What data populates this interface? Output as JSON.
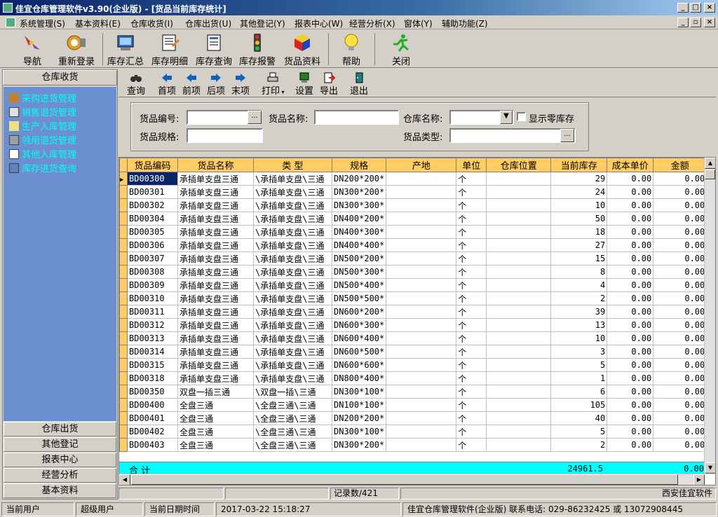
{
  "window": {
    "title": "佳宜仓库管理软件v3.90(企业版)  - [货品当前库存统计]"
  },
  "menu": [
    "系统管理(S)",
    "基本资料(E)",
    "仓库收货(I)",
    "仓库出货(U)",
    "其他登记(Y)",
    "报表中心(W)",
    "经营分析(X)",
    "窗体(Y)",
    "辅助功能(Z)"
  ],
  "toolbar": [
    {
      "label": "导航",
      "icon": "navigation-icon"
    },
    {
      "label": "重新登录",
      "icon": "relogin-icon"
    },
    {
      "label": "库存汇总",
      "icon": "inventory-summary-icon"
    },
    {
      "label": "库存明细",
      "icon": "inventory-detail-icon"
    },
    {
      "label": "库存查询",
      "icon": "inventory-query-icon"
    },
    {
      "label": "库存报警",
      "icon": "inventory-alarm-icon"
    },
    {
      "label": "货品资料",
      "icon": "goods-data-icon"
    },
    {
      "label": "帮助",
      "icon": "help-icon"
    },
    {
      "label": "关闭",
      "icon": "close-icon"
    }
  ],
  "sidebar": {
    "header": "仓库收货",
    "items": [
      "采购进货管理",
      "销售退货管理",
      "生产入库管理",
      "领用退货管理",
      "其他入库管理",
      "库存进货查询"
    ],
    "sections": [
      "仓库出货",
      "其他登记",
      "报表中心",
      "经营分析",
      "基本资料"
    ]
  },
  "subtoolbar": [
    "查询",
    "首项",
    "前项",
    "后项",
    "末项",
    "打印",
    "设置",
    "导出",
    "退出"
  ],
  "filter": {
    "code_label": "货品编号:",
    "name_label": "货品名称:",
    "warehouse_label": "仓库名称:",
    "zero_stock_label": "显示零库存",
    "spec_label": "货品规格:",
    "type_label": "货品类型:",
    "ellipsis": "..."
  },
  "grid": {
    "columns": [
      "货品编码",
      "货品名称",
      "类  型",
      "规格",
      "产地",
      "单位",
      "仓库位置",
      "当前库存",
      "成本单价",
      "金额"
    ],
    "rows": [
      [
        "BD00300",
        "承插单支盘三通",
        "\\承插单支盘\\三通",
        "DN200*200*",
        "",
        "个",
        "",
        "29",
        "0.00",
        "0.00"
      ],
      [
        "BD00301",
        "承插单支盘三通",
        "\\承插单支盘\\三通",
        "DN300*200*",
        "",
        "个",
        "",
        "24",
        "0.00",
        "0.00"
      ],
      [
        "BD00302",
        "承插单支盘三通",
        "\\承插单支盘\\三通",
        "DN300*300*",
        "",
        "个",
        "",
        "10",
        "0.00",
        "0.00"
      ],
      [
        "BD00304",
        "承插单支盘三通",
        "\\承插单支盘\\三通",
        "DN400*200*",
        "",
        "个",
        "",
        "50",
        "0.00",
        "0.00"
      ],
      [
        "BD00305",
        "承插单支盘三通",
        "\\承插单支盘\\三通",
        "DN400*300*",
        "",
        "个",
        "",
        "18",
        "0.00",
        "0.00"
      ],
      [
        "BD00306",
        "承插单支盘三通",
        "\\承插单支盘\\三通",
        "DN400*400*",
        "",
        "个",
        "",
        "27",
        "0.00",
        "0.00"
      ],
      [
        "BD00307",
        "承插单支盘三通",
        "\\承插单支盘\\三通",
        "DN500*200*",
        "",
        "个",
        "",
        "15",
        "0.00",
        "0.00"
      ],
      [
        "BD00308",
        "承插单支盘三通",
        "\\承插单支盘\\三通",
        "DN500*300*",
        "",
        "个",
        "",
        "8",
        "0.00",
        "0.00"
      ],
      [
        "BD00309",
        "承插单支盘三通",
        "\\承插单支盘\\三通",
        "DN500*400*",
        "",
        "个",
        "",
        "4",
        "0.00",
        "0.00"
      ],
      [
        "BD00310",
        "承插单支盘三通",
        "\\承插单支盘\\三通",
        "DN500*500*",
        "",
        "个",
        "",
        "2",
        "0.00",
        "0.00"
      ],
      [
        "BD00311",
        "承插单支盘三通",
        "\\承插单支盘\\三通",
        "DN600*200*",
        "",
        "个",
        "",
        "39",
        "0.00",
        "0.00"
      ],
      [
        "BD00312",
        "承插单支盘三通",
        "\\承插单支盘\\三通",
        "DN600*300*",
        "",
        "个",
        "",
        "13",
        "0.00",
        "0.00"
      ],
      [
        "BD00313",
        "承插单支盘三通",
        "\\承插单支盘\\三通",
        "DN600*400*",
        "",
        "个",
        "",
        "10",
        "0.00",
        "0.00"
      ],
      [
        "BD00314",
        "承插单支盘三通",
        "\\承插单支盘\\三通",
        "DN600*500*",
        "",
        "个",
        "",
        "3",
        "0.00",
        "0.00"
      ],
      [
        "BD00315",
        "承插单支盘三通",
        "\\承插单支盘\\三通",
        "DN600*600*",
        "",
        "个",
        "",
        "5",
        "0.00",
        "0.00"
      ],
      [
        "BD00318",
        "承插单支盘三通",
        "\\承插单支盘\\三通",
        "DN800*400*",
        "",
        "个",
        "",
        "1",
        "0.00",
        "0.00"
      ],
      [
        "BD00350",
        "双盘一插三通",
        "\\双盘一插\\三通",
        "DN300*100*",
        "",
        "个",
        "",
        "6",
        "0.00",
        "0.00"
      ],
      [
        "BD00400",
        "全盘三通",
        "\\全盘三通\\三通",
        "DN100*100*",
        "",
        "个",
        "",
        "105",
        "0.00",
        "0.00"
      ],
      [
        "BD00401",
        "全盘三通",
        "\\全盘三通\\三通",
        "DN200*200*",
        "",
        "个",
        "",
        "40",
        "0.00",
        "0.00"
      ],
      [
        "BD00402",
        "全盘三通",
        "\\全盘三通\\三通",
        "DN300*100*",
        "",
        "个",
        "",
        "5",
        "0.00",
        "0.00"
      ],
      [
        "BD00403",
        "全盘三通",
        "\\全盘三通\\三通",
        "DN300*200*",
        "",
        "个",
        "",
        "2",
        "0.00",
        "0.00"
      ]
    ],
    "summary": {
      "label": "合  计",
      "stock": "24961.5",
      "amount": "0.00"
    }
  },
  "recbar": {
    "count": "记录数/421",
    "vendor": "西安佳宜软件"
  },
  "status": {
    "user_label": "当前用户",
    "user_value": "超级用户",
    "date_label": "当前日期时间",
    "datetime": "2017-03-22 15:18:27",
    "company": "佳宜仓库管理软件(企业版) 联系电话: 029-86232425 或 13072908445"
  }
}
